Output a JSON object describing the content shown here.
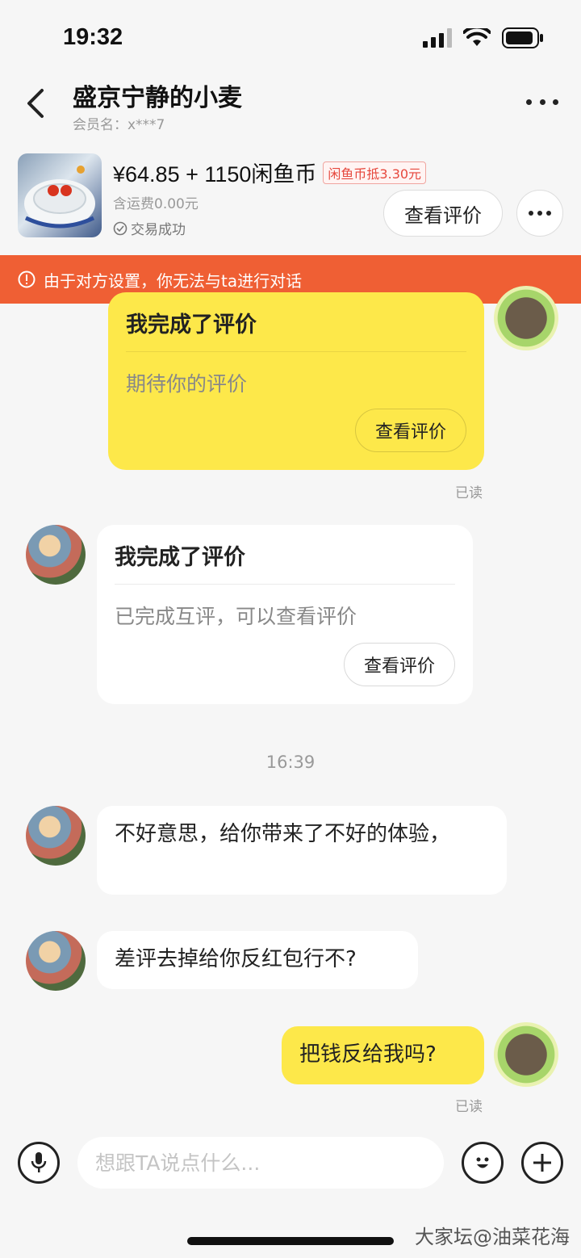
{
  "status_bar": {
    "time": "19:32"
  },
  "nav": {
    "title": "盛京宁静的小麦",
    "member_name": "会员名：x***7"
  },
  "product": {
    "price": "¥64.85 + 1150闲鱼币",
    "coin_deduction": "闲鱼币抵3.30元",
    "shipping": "含运费0.00元",
    "deal_status": "交易成功",
    "view_review_label": "查看评价"
  },
  "warning": {
    "text": "由于对方设置，你无法与ta进行对话"
  },
  "messages": {
    "my_review_card": {
      "title": "我完成了评价",
      "body": "期待你的评价",
      "button": "查看评价",
      "read": "已读"
    },
    "their_review_card": {
      "title": "我完成了评价",
      "body": "已完成互评，可以查看评价",
      "button": "查看评价"
    },
    "timestamp": "16:39",
    "their_msg_1": "不好意思，给你带来了不好的体验，",
    "their_msg_2": "差评去掉给你反红包行不?",
    "my_msg_1": "把钱反给我吗?",
    "my_msg_1_read": "已读"
  },
  "input": {
    "placeholder": "想跟TA说点什么..."
  },
  "watermark": "大家坛@油菜花海",
  "colors": {
    "accent_yellow": "#fde84a",
    "warning_orange": "#ef5f34",
    "badge_red": "#e6483d"
  }
}
